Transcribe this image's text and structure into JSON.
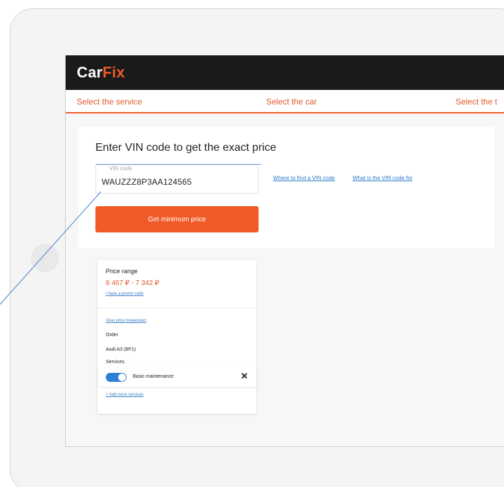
{
  "brand": {
    "part1": "Car",
    "part2": "Fix"
  },
  "steps": [
    "Select the service",
    "Select the car",
    "Select the t"
  ],
  "vin": {
    "title": "Enter VIN code to get the exact price",
    "field_label": "VIN code",
    "field_value": "WAUZZZ8P3AA124565",
    "link_where": "Where to find a VIN code",
    "link_what": "What is the VIN code for",
    "button_label": "Get minimum price"
  },
  "summary": {
    "price_label": "Price range",
    "price_value": "6 467 ₽ - 7 342 ₽",
    "promo_link": "I have a promo code",
    "breakdown_link": "View price breakdown",
    "order_label": "Order",
    "car_name": "Audi A3 (8P1)",
    "services_label": "Services",
    "service_name": "Basic maintenance",
    "remove_glyph": "✕",
    "add_services_link": "+ Add more services"
  },
  "colors": {
    "accent": "#f05a28",
    "topbar": "#1a1a1a",
    "link": "#2a78c8",
    "toggle": "#2f7fd6"
  }
}
